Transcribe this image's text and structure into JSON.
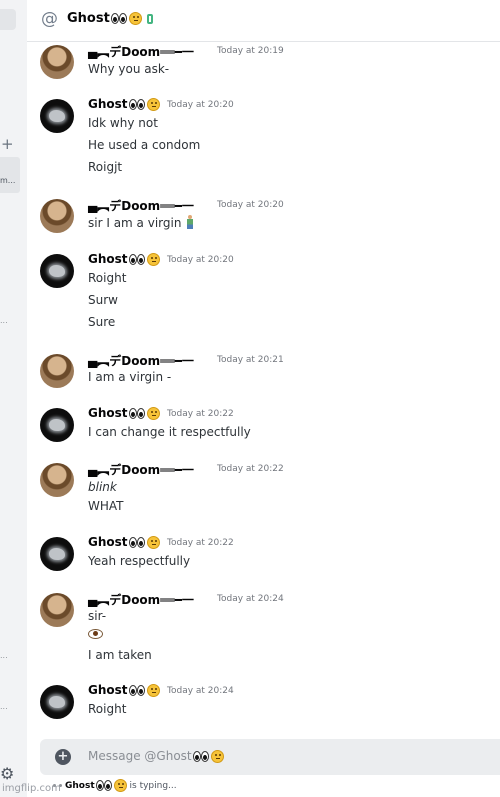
{
  "header": {
    "at_symbol": "@",
    "username": "Ghost"
  },
  "composer": {
    "placeholder": "Message @Ghost"
  },
  "typing": {
    "user": "Ghost",
    "suffix": "is typing..."
  },
  "sidebar": {
    "plus": "+",
    "selected_abbrev": "m...",
    "dots": [
      "...",
      "...",
      "..."
    ],
    "gear": "⚙"
  },
  "watermark": "imgflip.com",
  "users": {
    "doom": {
      "name": "▄︻デDoom══━一"
    },
    "ghost": {
      "name": "Ghost"
    }
  },
  "messages": [
    {
      "author": "Doom",
      "name": "▄︻デDoom══━一",
      "time": "Today at 20:19",
      "lines": [
        "Why you ask-"
      ]
    },
    {
      "author": "Ghost",
      "name": "Ghost",
      "time": "Today at 20:20",
      "lines": [
        "Idk why not",
        "He used a condom",
        "Roigjt"
      ]
    },
    {
      "author": "Doom",
      "name": "▄︻デDoom══━一",
      "time": "Today at 20:20",
      "lines": [
        "sir I am a virgin"
      ]
    },
    {
      "author": "Ghost",
      "name": "Ghost",
      "time": "Today at 20:20",
      "lines": [
        "Roight",
        "Surw",
        "Sure"
      ]
    },
    {
      "author": "Doom",
      "name": "▄︻デDoom══━一",
      "time": "Today at 20:21",
      "lines": [
        "I am a virgin -"
      ]
    },
    {
      "author": "Ghost",
      "name": "Ghost",
      "time": "Today at 20:22",
      "lines": [
        "I can change it respectfully"
      ]
    },
    {
      "author": "Doom",
      "name": "▄︻デDoom══━一",
      "time": "Today at 20:22",
      "lines": [
        "blink",
        "WHAT"
      ]
    },
    {
      "author": "Ghost",
      "name": "Ghost",
      "time": "Today at 20:22",
      "lines": [
        "Yeah respectfully"
      ]
    },
    {
      "author": "Doom",
      "name": "▄︻デDoom══━一",
      "time": "Today at 20:24",
      "lines": [
        "sir-",
        "I am taken"
      ]
    },
    {
      "author": "Ghost",
      "name": "Ghost",
      "time": "Today at 20:24",
      "lines": [
        "Roight"
      ]
    }
  ]
}
